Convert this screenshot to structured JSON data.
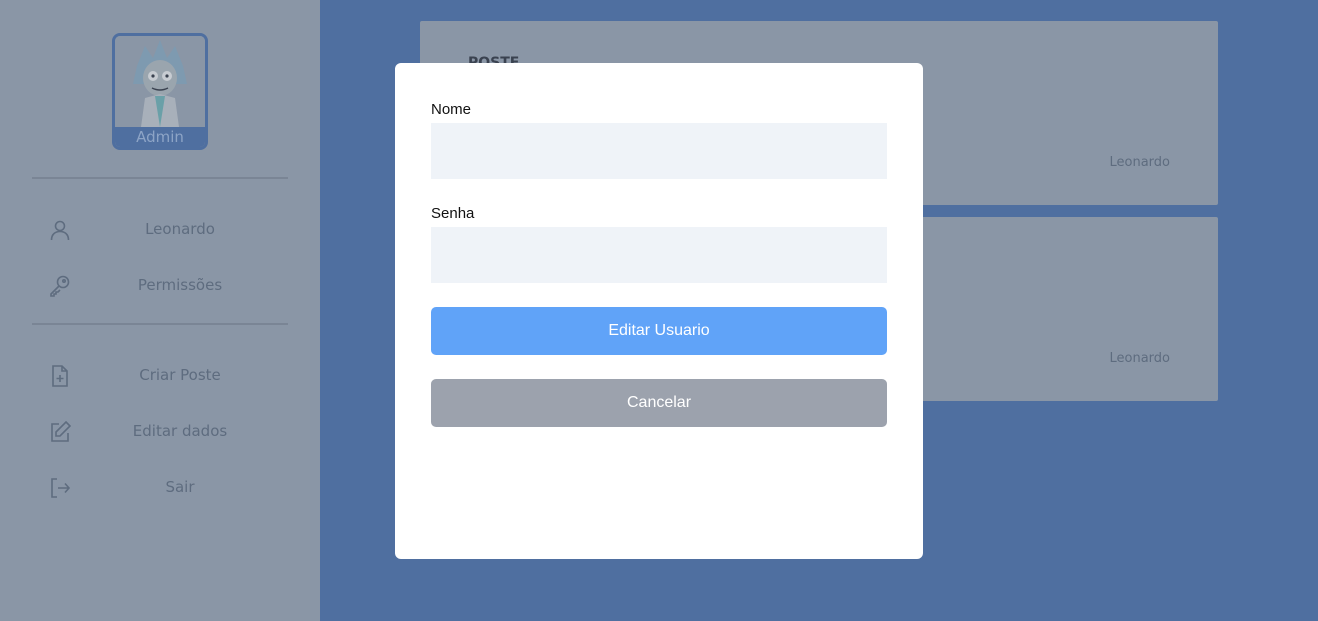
{
  "sidebar": {
    "avatar_label": "Admin",
    "items": [
      {
        "label": "Leonardo",
        "icon": "user-icon"
      },
      {
        "label": "Permissões",
        "icon": "key-icon"
      },
      {
        "label": "Criar Poste",
        "icon": "file-plus-icon"
      },
      {
        "label": "Editar dados",
        "icon": "edit-icon"
      },
      {
        "label": "Sair",
        "icon": "logout-icon"
      }
    ]
  },
  "posts": [
    {
      "title": "POSTE",
      "author": "Leonardo"
    },
    {
      "title": "",
      "author": "Leonardo"
    }
  ],
  "modal": {
    "name_label": "Nome",
    "name_value": "",
    "password_label": "Senha",
    "password_value": "",
    "submit_label": "Editar Usuario",
    "cancel_label": "Cancelar"
  },
  "colors": {
    "background": "#4f6fa0",
    "primary_button": "#60a3f8",
    "secondary_button": "#9ca2ad",
    "input_bg": "#eff3f8"
  }
}
